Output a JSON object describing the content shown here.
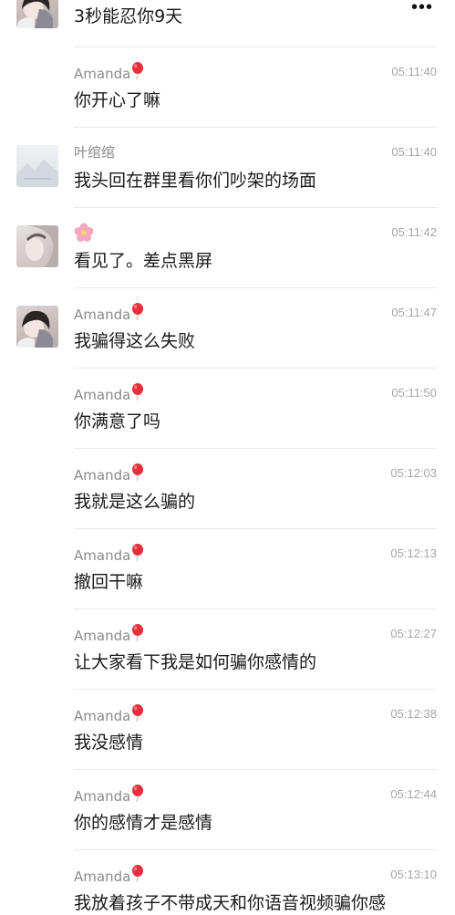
{
  "header": {
    "more_glyph": "•••"
  },
  "messages": [
    {
      "name": "",
      "time": "",
      "text": "3秒能忍你9天"
    },
    {
      "name": "Amanda",
      "time": "05:11:40",
      "text": "你开心了嘛"
    },
    {
      "name": "叶绾绾",
      "time": "05:11:40",
      "text": "我头回在群里看你们吵架的场面"
    },
    {
      "name": "",
      "time": "05:11:42",
      "text": "看见了。差点黑屏"
    },
    {
      "name": "Amanda",
      "time": "05:11:47",
      "text": "我骗得这么失败"
    },
    {
      "name": "Amanda",
      "time": "05:11:50",
      "text": "你满意了吗"
    },
    {
      "name": "Amanda",
      "time": "05:12:03",
      "text": "我就是这么骗的"
    },
    {
      "name": "Amanda",
      "time": "05:12:13",
      "text": "撤回干嘛"
    },
    {
      "name": "Amanda",
      "time": "05:12:27",
      "text": "让大家看下我是如何骗你感情的"
    },
    {
      "name": "Amanda",
      "time": "05:12:38",
      "text": "我没感情"
    },
    {
      "name": "Amanda",
      "time": "05:12:44",
      "text": "你的感情才是感情"
    },
    {
      "name": "Amanda",
      "time": "05:13:10",
      "text": "我放着孩子不带成天和你语音视频骗你感"
    }
  ],
  "colors": {
    "name": "#8b8b8b",
    "time": "#a6a6a6",
    "text": "#1a1a1a",
    "separator": "#e9e9e9",
    "balloon": "#e8303c"
  },
  "icons": {
    "name_badge": "red-balloon-emoji",
    "flower": "pink-flower-emoji",
    "more": "more-dots-icon"
  }
}
